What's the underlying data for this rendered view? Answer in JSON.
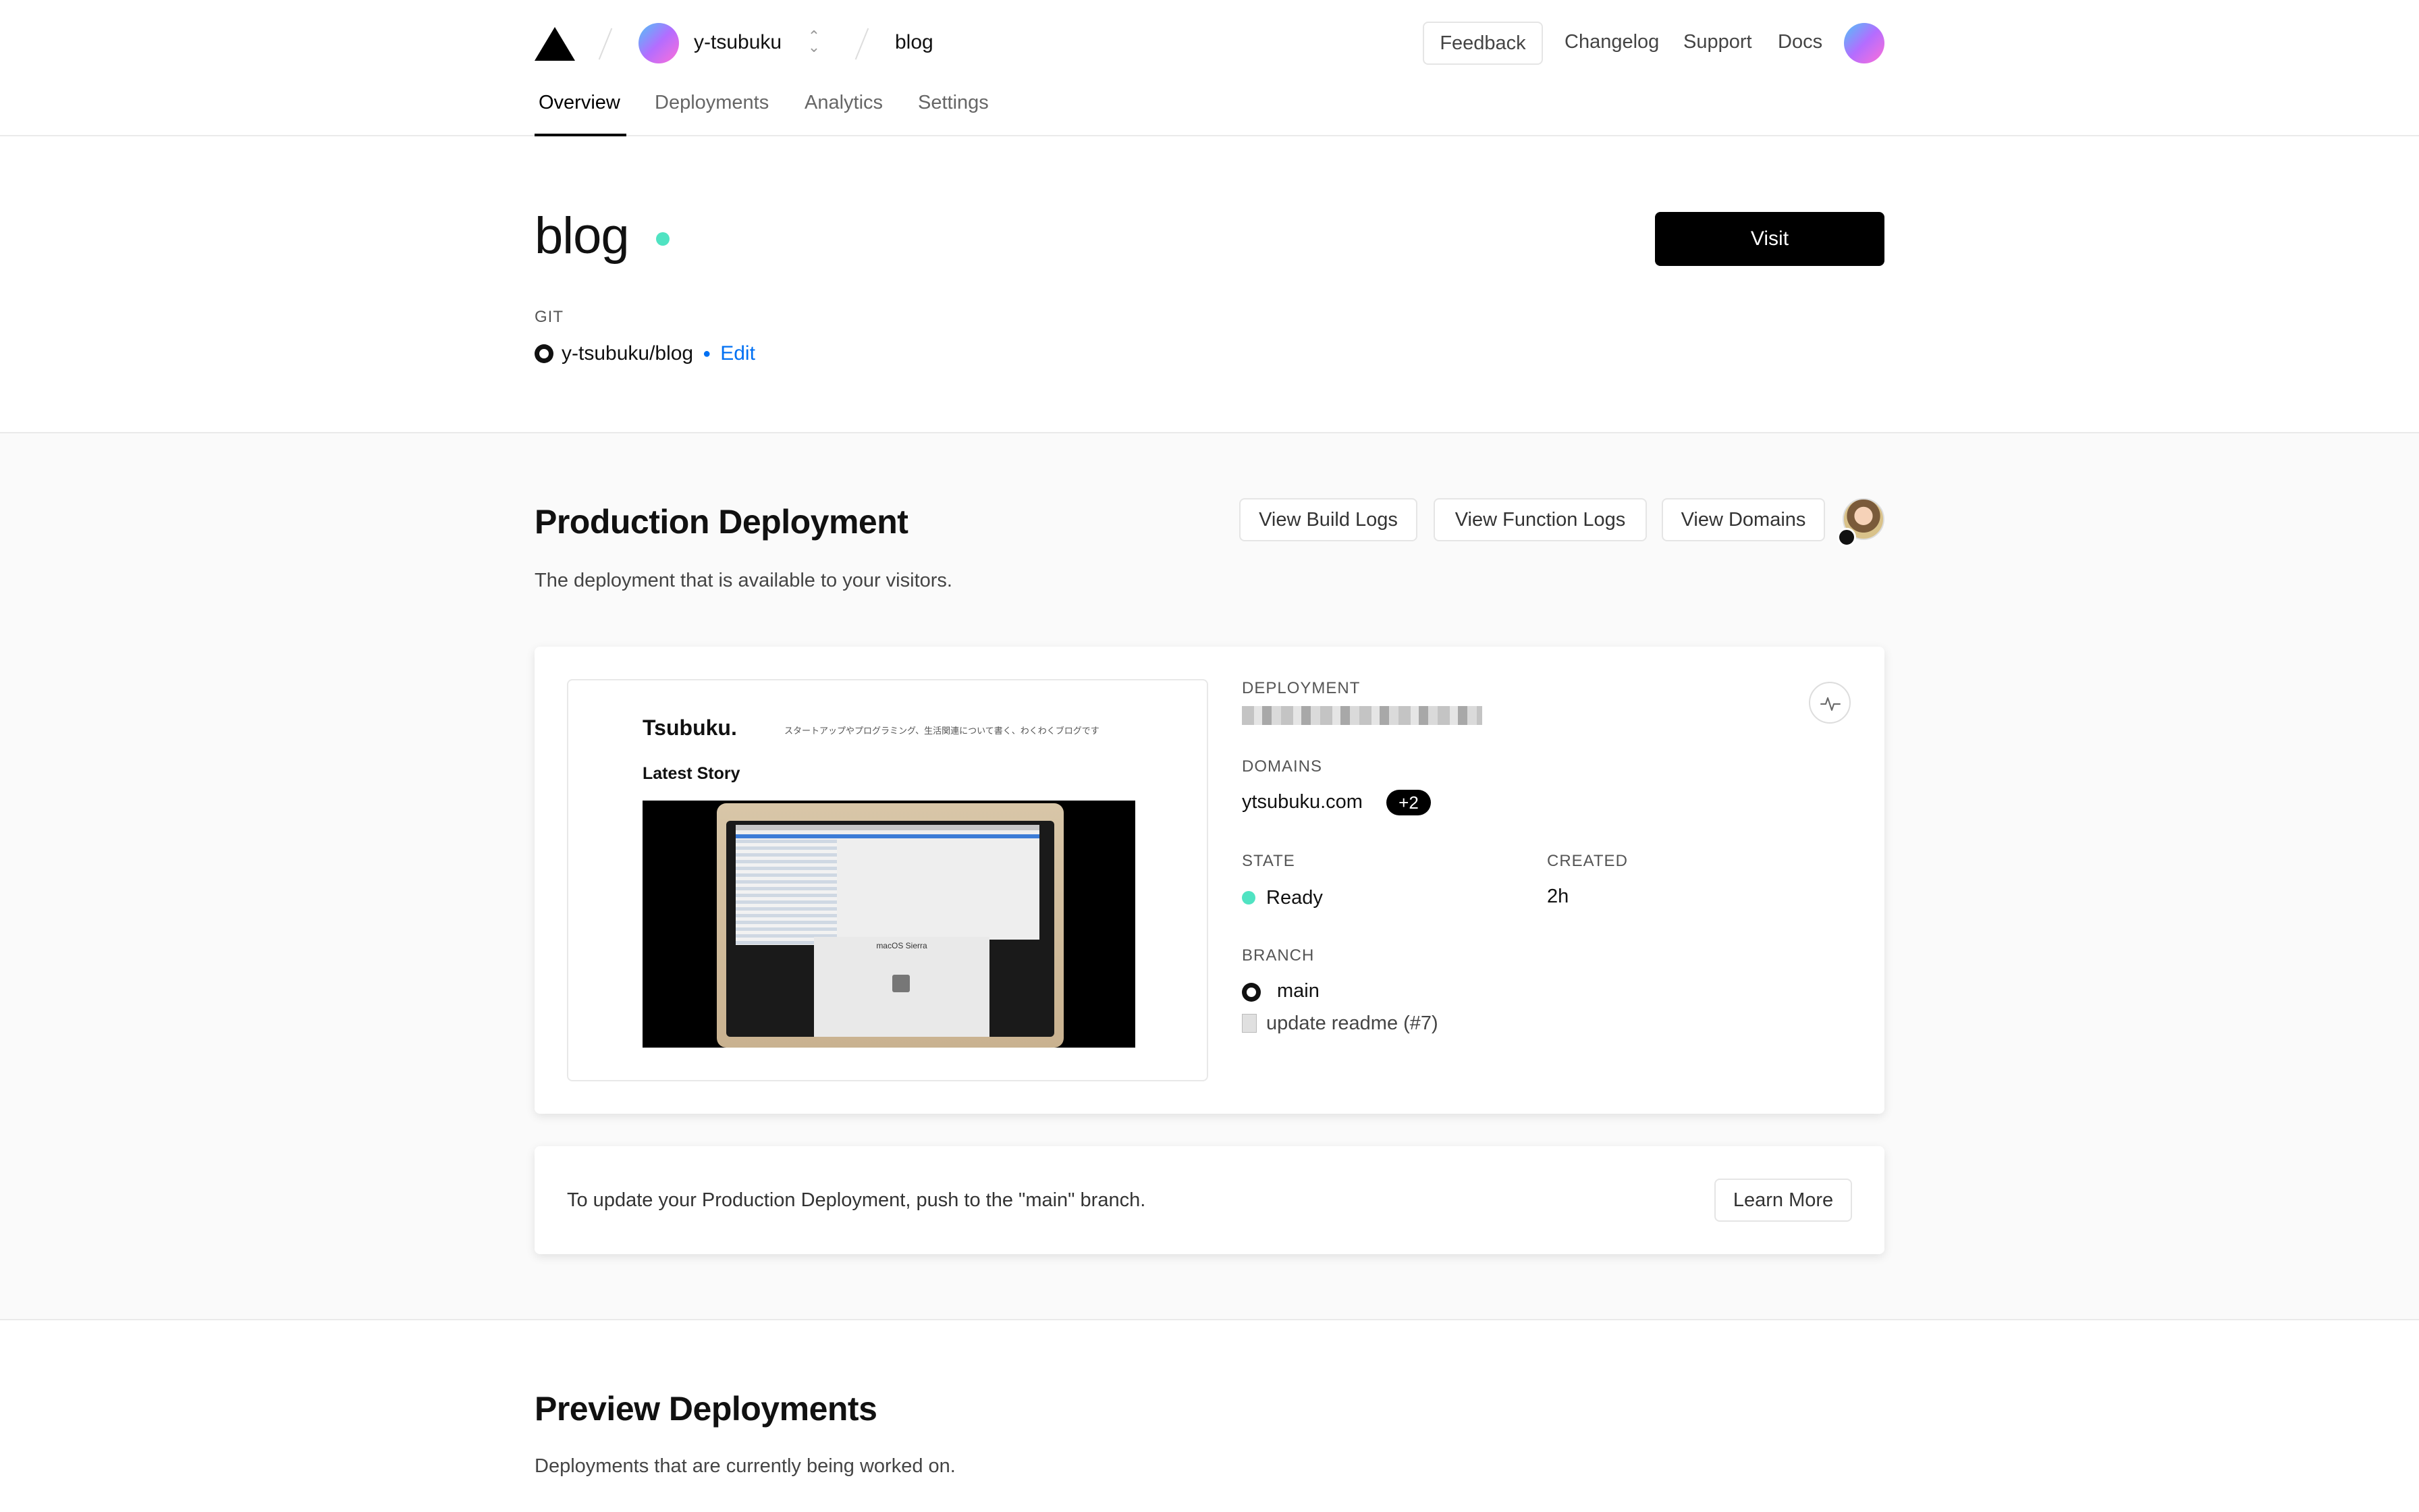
{
  "header": {
    "team": "y-tsubuku",
    "project": "blog",
    "feedback": "Feedback",
    "links": [
      "Changelog",
      "Support",
      "Docs"
    ]
  },
  "tabs": [
    {
      "label": "Overview",
      "active": true
    },
    {
      "label": "Deployments",
      "active": false
    },
    {
      "label": "Analytics",
      "active": false
    },
    {
      "label": "Settings",
      "active": false
    }
  ],
  "project": {
    "title": "blog",
    "visit": "Visit",
    "git_label": "GIT",
    "repo": "y-tsubuku/blog",
    "edit": "Edit"
  },
  "production": {
    "title": "Production Deployment",
    "subtitle": "The deployment that is available to your visitors.",
    "buttons": [
      "View Build Logs",
      "View Function Logs",
      "View Domains"
    ],
    "preview": {
      "brand": "Tsubuku.",
      "tagline": "スタートアップやプログラミング、生活関連について書く、わくわくブログです",
      "latest": "Latest Story",
      "installer": "macOS Sierra"
    },
    "deployment_label": "DEPLOYMENT",
    "domains_label": "DOMAINS",
    "domain": "ytsubuku.com",
    "domain_extra": "+2",
    "state_label": "STATE",
    "state": "Ready",
    "created_label": "CREATED",
    "created": "2h",
    "branch_label": "BRANCH",
    "branch": "main",
    "commit": "update readme (#7)",
    "info": "To update your Production Deployment, push to the \"main\" branch.",
    "learn_more": "Learn More"
  },
  "preview_deployments": {
    "title": "Preview Deployments",
    "subtitle": "Deployments that are currently being worked on."
  },
  "colors": {
    "accent": "#0070f3",
    "ready": "#50e3c2",
    "primary": "#000000"
  }
}
